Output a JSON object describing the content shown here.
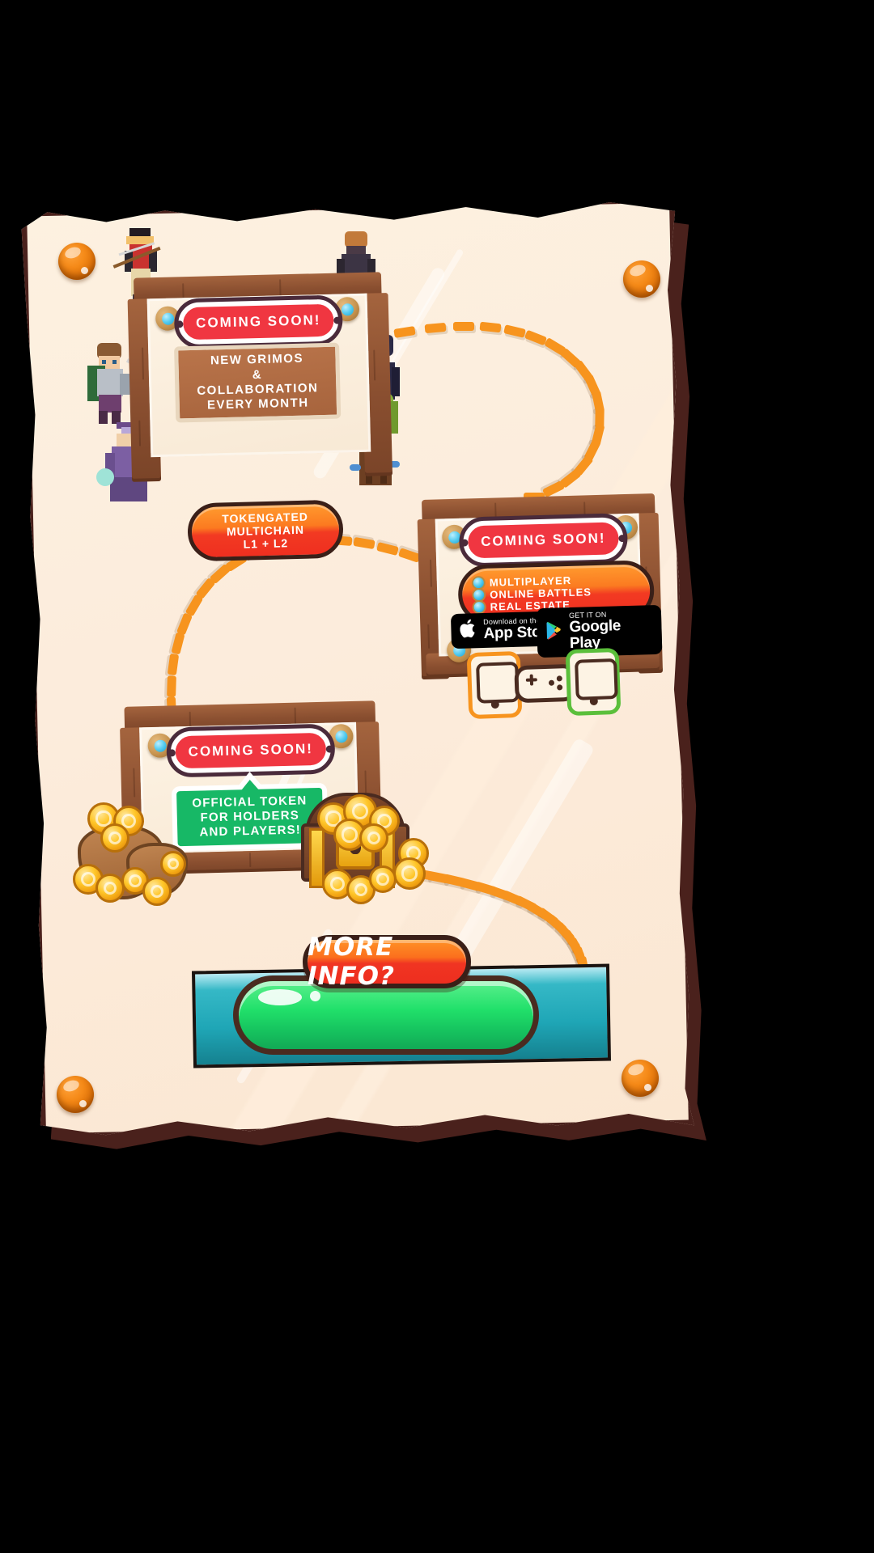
{
  "page": {
    "background_color": "#000000",
    "paper_color": "#fdf1e0",
    "border_color": "#4a211c"
  },
  "colors": {
    "accent_orange": "#f7941e",
    "accent_red": "#f03641",
    "accent_green": "#17b866",
    "accent_teal": "#1fa6b6",
    "dark_brown": "#4a2b20",
    "wood": "#8a4f30"
  },
  "roadmap": {
    "signs": [
      {
        "id": "sign-grimos",
        "badge": "COMING SOON!",
        "body_lines": [
          "NEW GRIMOS",
          "&",
          "COLLABORATION",
          "EVERY MONTH"
        ],
        "pill_lines": [
          "TOKENGATED",
          "MULTICHAIN",
          "L1 + L2"
        ]
      },
      {
        "id": "sign-game",
        "badge": "COMING SOON!",
        "bullets": [
          "MULTIPLAYER",
          "ONLINE BATTLES",
          "REAL ESTATE"
        ],
        "store_badges": [
          {
            "name": "app-store",
            "small": "Download on the",
            "big": "App Store",
            "icon": "apple-icon"
          },
          {
            "name": "google-play",
            "small": "GET IT ON",
            "big": "Google Play",
            "icon": "google-play-icon"
          }
        ]
      },
      {
        "id": "sign-token",
        "badge": "COMING SOON!",
        "body_lines": [
          "OFFICIAL TOKEN",
          "FOR HOLDERS",
          "AND PLAYERS!"
        ]
      }
    ]
  },
  "cta": {
    "more_info_label": "MORE INFO?",
    "input_value": "",
    "input_placeholder": ""
  },
  "icons": {
    "rivet": "gem-rivet-icon",
    "screw": "orange-screw-icon",
    "path": "dashed-path-icon",
    "chest": "treasure-chest-icon",
    "coin": "gold-coin-icon",
    "sack": "coin-sack-icon",
    "phone": "phone-icon",
    "gamepad": "gamepad-icon",
    "apple": "apple-icon",
    "google_play": "google-play-icon"
  },
  "characters": [
    {
      "name": "character-archer",
      "label": "archer"
    },
    {
      "name": "character-knight",
      "label": "knight"
    },
    {
      "name": "character-warrior",
      "label": "warrior"
    },
    {
      "name": "character-mage",
      "label": "mage"
    },
    {
      "name": "character-witch",
      "label": "witch"
    },
    {
      "name": "character-dryad",
      "label": "dryad"
    }
  ]
}
